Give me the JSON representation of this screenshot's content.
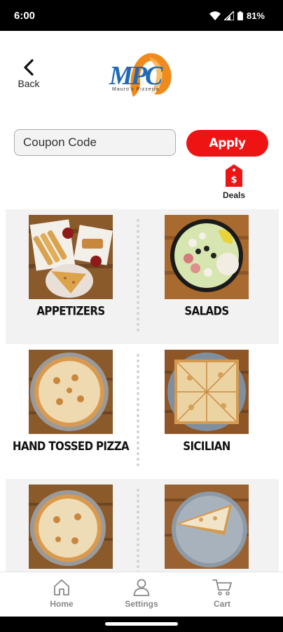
{
  "status_bar": {
    "time": "6:00",
    "battery": "81%",
    "icons": [
      "wifi-icon",
      "signal-icon",
      "battery-icon"
    ]
  },
  "header": {
    "back_label": "Back",
    "logo_text": "MPC",
    "logo_subtitle": "Mauro's Pizzeria"
  },
  "coupon": {
    "placeholder": "Coupon Code",
    "apply_label": "Apply"
  },
  "deals": {
    "label": "Deals",
    "icon": "price-tag-dollar-icon"
  },
  "categories": [
    {
      "label": "APPETIZERS"
    },
    {
      "label": "SALADS"
    },
    {
      "label": "HAND TOSSED PIZZA"
    },
    {
      "label": "SICILIAN"
    },
    {
      "label": ""
    },
    {
      "label": ""
    }
  ],
  "bottom_nav": {
    "items": [
      {
        "label": "Home",
        "icon": "home-icon"
      },
      {
        "label": "Settings",
        "icon": "user-icon"
      },
      {
        "label": "Cart",
        "icon": "cart-icon"
      }
    ]
  },
  "colors": {
    "accent": "#ee1414",
    "logo_blue": "#1f6ab5",
    "logo_orange": "#f08a1c",
    "nav_gray": "#888888"
  }
}
